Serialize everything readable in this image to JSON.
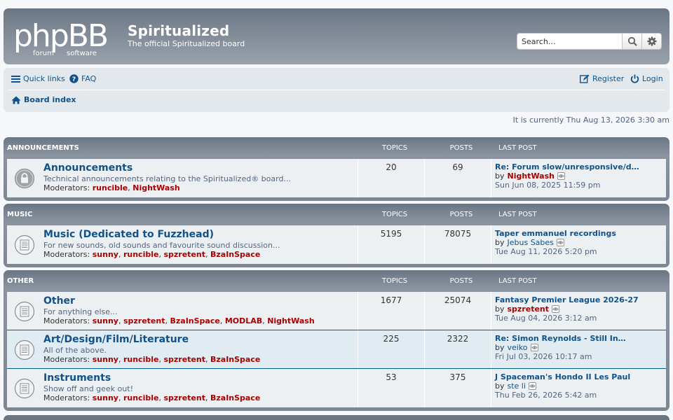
{
  "header": {
    "logo_text": "phpBB",
    "logo_sub_left": "forum",
    "logo_sub_right": "software",
    "site_title": "Spiritualized",
    "site_description": "The official Spiritualized board",
    "search_placeholder": "Search…"
  },
  "nav": {
    "quick_links": "Quick links",
    "faq": "FAQ",
    "register": "Register",
    "login": "Login",
    "board_index": "Board index"
  },
  "current_time": "It is currently Thu Aug 13, 2026 3:30 am",
  "columns": {
    "topics": "TOPICS",
    "posts": "POSTS",
    "last_post": "LAST POST"
  },
  "categories": [
    {
      "name": "ANNOUNCEMENTS",
      "forums": [
        {
          "title": "Announcements",
          "description": "Technical announcements relating to the Spiritualized® board...",
          "moderators_label": "Moderators:",
          "moderators": [
            "runcible",
            "NightWash"
          ],
          "topics": "20",
          "posts": "69",
          "last_title": "Re: Forum slow/unresponsive/d…",
          "last_by": "by",
          "last_user": "NightWash",
          "last_user_red": true,
          "last_date": "Sun Jun 08, 2025 11:59 pm",
          "locked": true
        }
      ]
    },
    {
      "name": "MUSIC",
      "forums": [
        {
          "title": "Music (Dedicated to Fuzzhead)",
          "description": "For new sounds, old sounds and favourite sound discussion...",
          "moderators_label": "Moderators:",
          "moderators": [
            "sunny",
            "runcible",
            "spzretent",
            "BzaInSpace"
          ],
          "topics": "5195",
          "posts": "78075",
          "last_title": "Taper emmanuel recordings",
          "last_by": "by",
          "last_user": "Jebus Sabes",
          "last_user_red": false,
          "last_date": "Tue Aug 11, 2026 5:20 pm",
          "locked": false
        }
      ]
    },
    {
      "name": "OTHER",
      "forums": [
        {
          "title": "Other",
          "description": "For anything else...",
          "moderators_label": "Moderators:",
          "moderators": [
            "sunny",
            "spzretent",
            "BzaInSpace",
            "MODLAB",
            "NightWash"
          ],
          "topics": "1677",
          "posts": "25074",
          "last_title": "Fantasy Premier League 2026-27",
          "last_by": "by",
          "last_user": "spzretent",
          "last_user_red": true,
          "last_date": "Tue Aug 04, 2026 3:12 am",
          "locked": false
        },
        {
          "title": "Art/Design/Film/Literature",
          "description": "All of the above.",
          "moderators_label": "Moderators:",
          "moderators": [
            "sunny",
            "runcible",
            "spzretent",
            "BzaInSpace"
          ],
          "topics": "225",
          "posts": "2322",
          "last_title": "Re: Simon Reynolds - Still In…",
          "last_by": "by",
          "last_user": "veiko",
          "last_user_red": false,
          "last_date": "Fri Jul 03, 2026 10:17 am",
          "locked": false
        },
        {
          "title": "Instruments",
          "description": "Show off and geek out!",
          "moderators_label": "Moderators:",
          "moderators": [
            "sunny",
            "runcible",
            "spzretent",
            "BzaInSpace"
          ],
          "topics": "53",
          "posts": "375",
          "last_title": "J Spaceman's Hondo II Les Paul",
          "last_by": "by",
          "last_user": "ste li",
          "last_user_red": false,
          "last_date": "Thu Feb 26, 2026 5:42 am",
          "locked": false
        }
      ]
    }
  ],
  "colors": {
    "link": "#105289",
    "moderator": "#aa0000",
    "header_bg": "#818b98",
    "row_bg": "#ecf0f3"
  }
}
